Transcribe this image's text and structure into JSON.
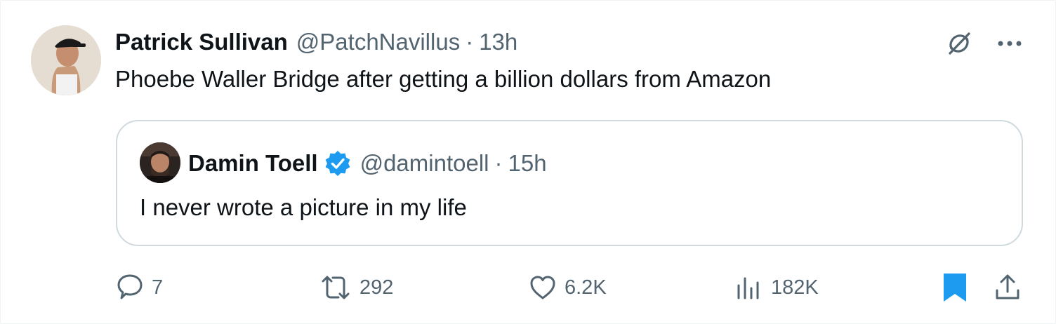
{
  "tweet": {
    "author_name": "Patrick Sullivan",
    "author_handle": "@PatchNavillus",
    "separator": "·",
    "time": "13h",
    "text": "Phoebe Waller Bridge after getting a billion dollars from Amazon"
  },
  "quoted_tweet": {
    "author_name": "Damin Toell",
    "author_handle": "@damintoell",
    "separator": "·",
    "time": "15h",
    "text": "I never wrote a picture in my life",
    "verified": true
  },
  "actions": {
    "replies": "7",
    "reposts": "292",
    "likes": "6.2K",
    "views": "182K"
  },
  "colors": {
    "text": "#0f1419",
    "secondary": "#536471",
    "accent": "#1d9bf0",
    "border": "#cfd9de"
  },
  "icons": {
    "grok": "grok-icon",
    "more": "more-icon",
    "reply": "reply-icon",
    "repost": "repost-icon",
    "like": "heart-icon",
    "views": "views-icon",
    "bookmark": "bookmark-icon",
    "share": "share-icon",
    "verified": "verified-badge-icon"
  }
}
